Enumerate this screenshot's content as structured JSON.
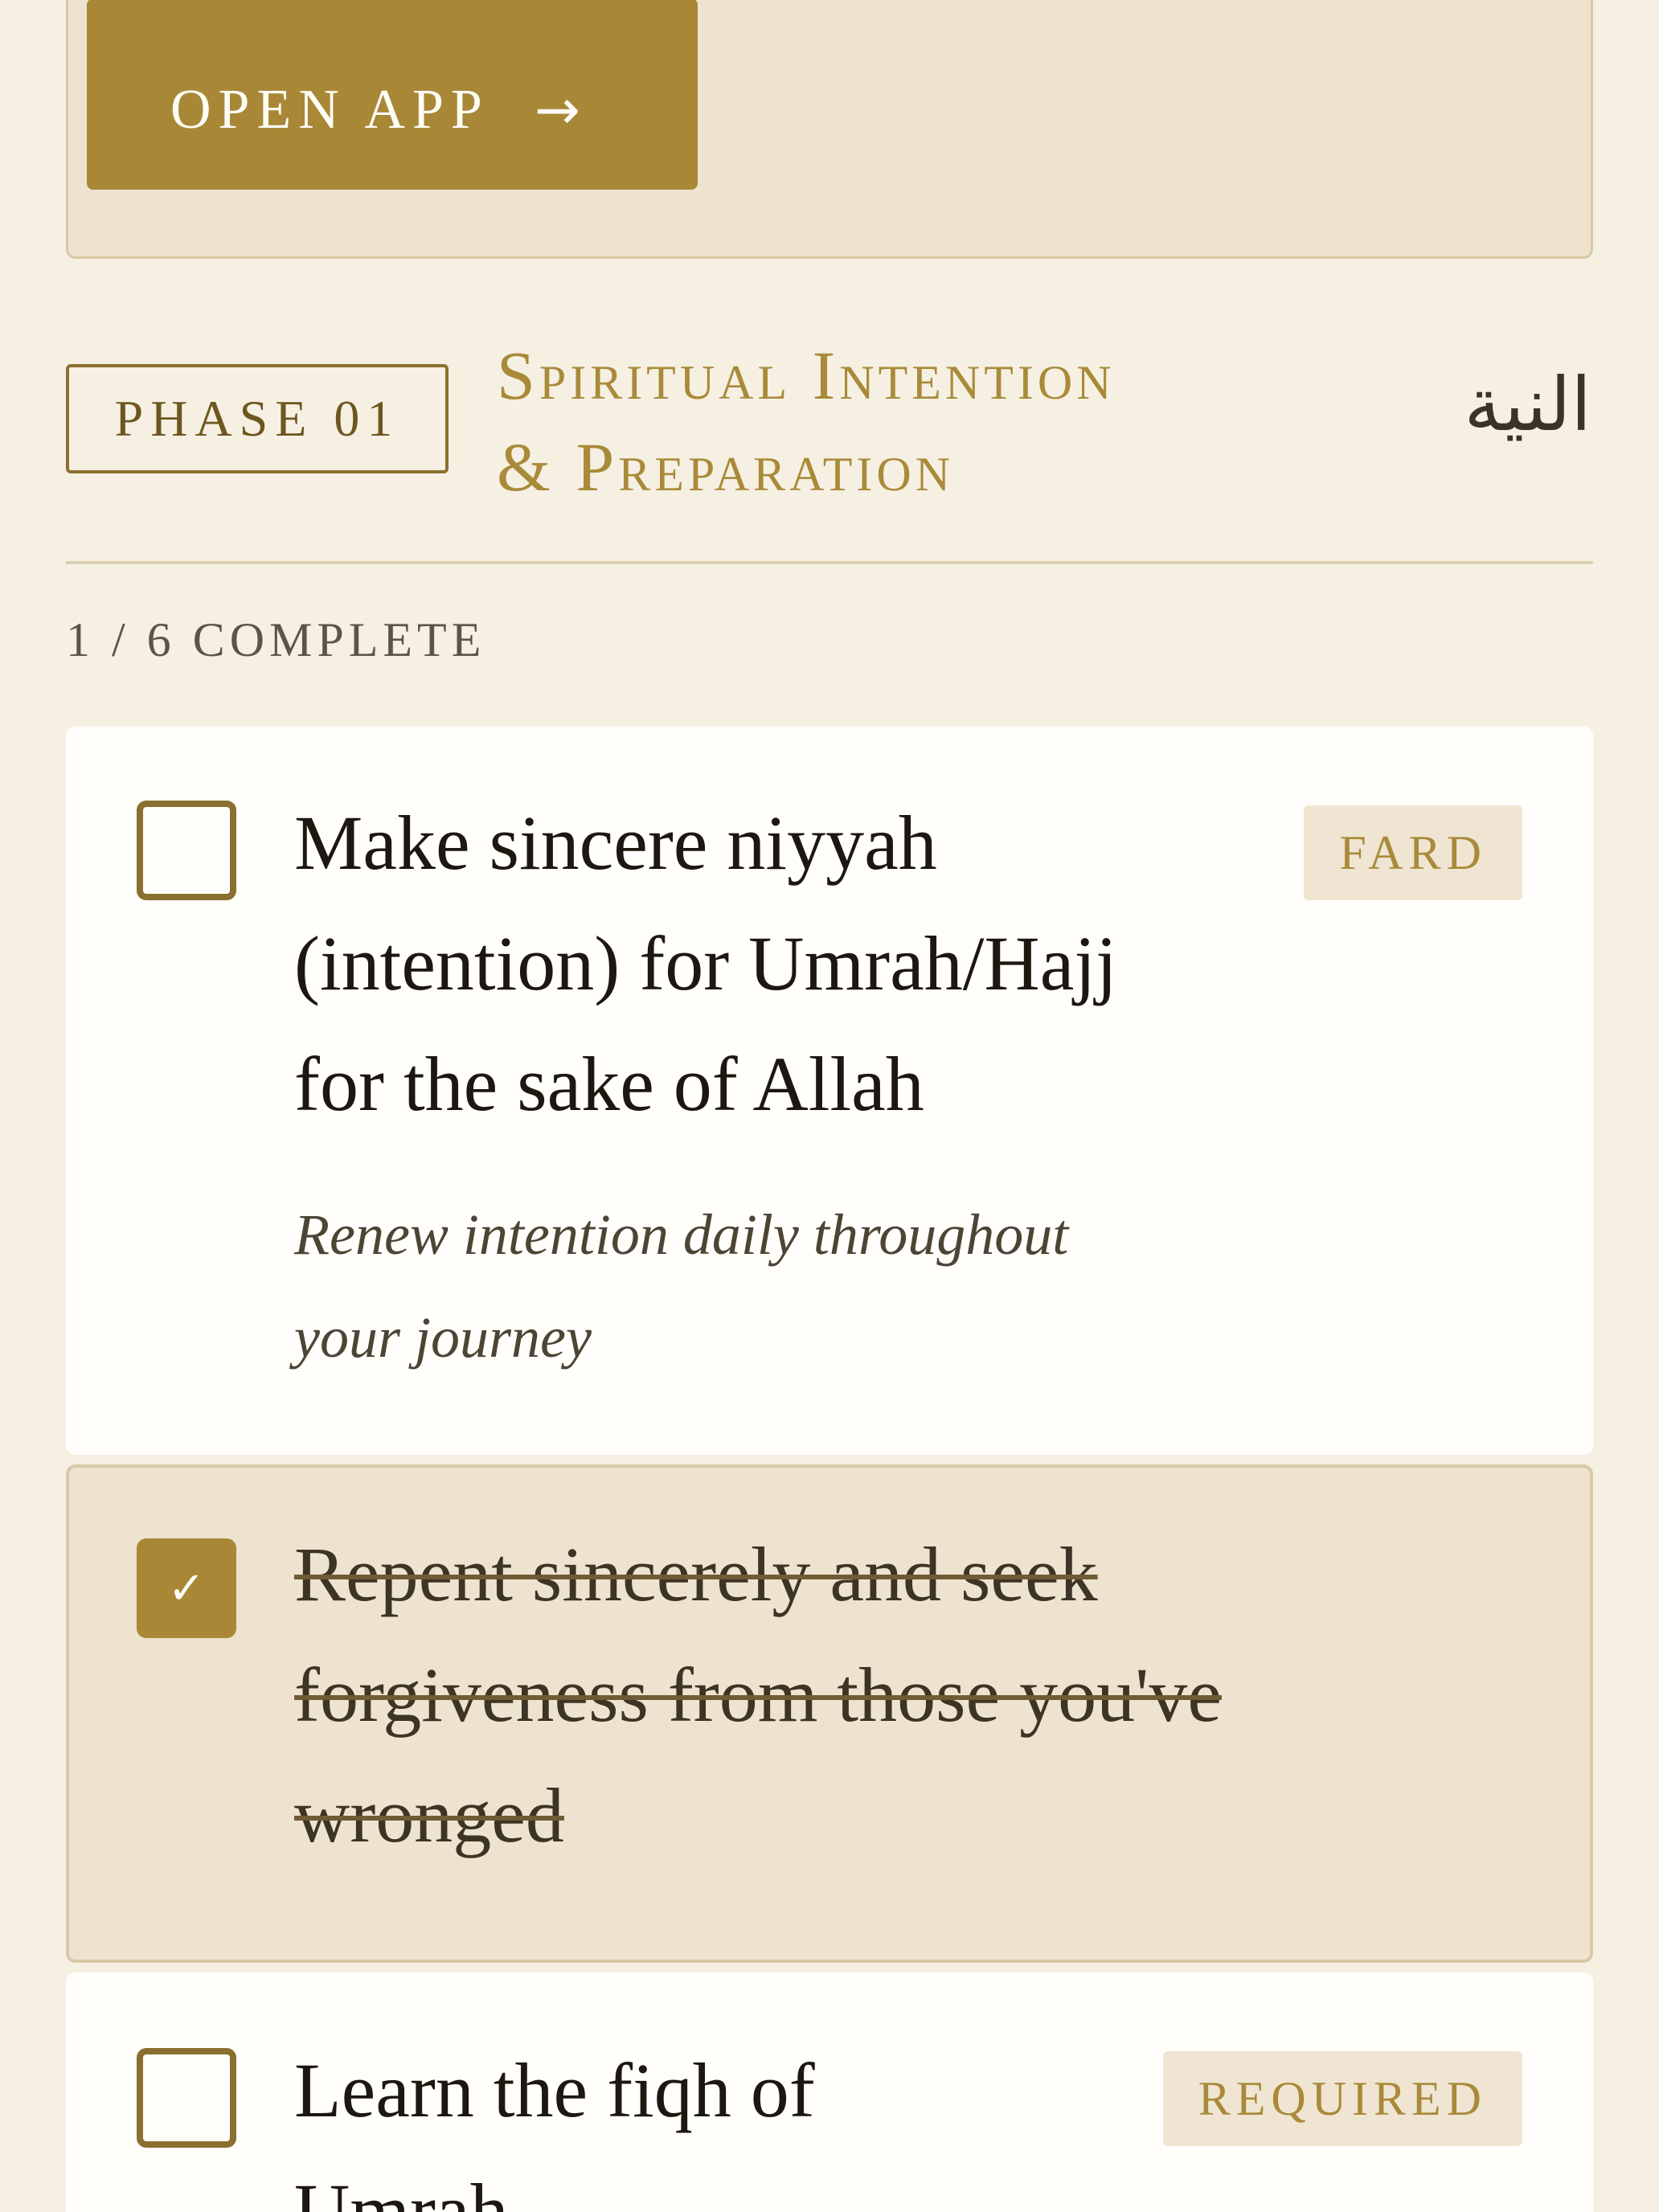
{
  "promo": {
    "open_app_label": "OPEN APP",
    "arrow_glyph": "→"
  },
  "phase": {
    "badge": "PHASE 01",
    "title_line1": "Spiritual Intention",
    "title_line2": "& Preparation",
    "arabic": "النية",
    "progress": "1 / 6 COMPLETE"
  },
  "items": [
    {
      "title_lines": [
        "Make sincere niyyah",
        "(intention) for Umrah/Hajj",
        "for the sake of Allah"
      ],
      "note_lines": [
        "Renew intention daily throughout",
        "your journey"
      ],
      "tag": "FARD",
      "checked": false
    },
    {
      "title_lines": [
        "Repent sincerely and seek",
        "forgiveness from those you've",
        "wronged"
      ],
      "checked": true,
      "check_glyph": "✓"
    },
    {
      "title_lines": [
        "Learn the fiqh of",
        "Umrah"
      ],
      "tag": "REQUIRED",
      "checked": false
    }
  ],
  "colors": {
    "background": "#f6f0e3",
    "gold": "#a88837",
    "dark_gold": "#8b6f2f",
    "card": "#fffefa",
    "card_checked": "#eee3cf"
  }
}
